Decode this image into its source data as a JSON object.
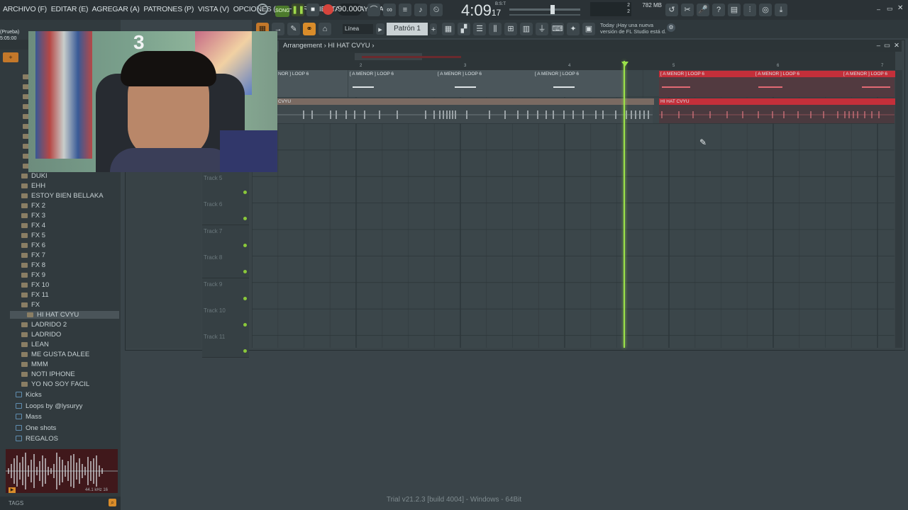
{
  "menu": [
    "ARCHIVO (F)",
    "EDITAR (E)",
    "AGREGAR (A)",
    "PATRONES (P)",
    "VISTA (V)",
    "OPCIONES (O)",
    "HERRAMIENTAS (T)",
    "AYUDA"
  ],
  "transport": {
    "song_label": "SONG",
    "tempo": "90.000",
    "time_main": "4:09",
    "time_sub": "17",
    "bst": "B:S:T",
    "cpu_a": "2",
    "cpu_b": "2",
    "memory": "782 MB"
  },
  "toolbar2": {
    "snap": "Línea",
    "pattern": "Patrón 1"
  },
  "hint": {
    "line1": "Today  ¡Hay una nueva",
    "line2": "versión de FL Studio está d."
  },
  "sidebar_status": {
    "line1": "(Prueba)",
    "line2": "5:05:00"
  },
  "browser": {
    "items": [
      "DUKI",
      "EHH",
      "ESTOY BIEN BELLAKA",
      "FX 2",
      "FX 3",
      "FX 4",
      "FX 5",
      "FX 6",
      "FX 7",
      "FX 8",
      "FX 9",
      "FX 10",
      "FX 11",
      "FX",
      "HI HAT CVYU",
      "LADRIDO 2",
      "LADRIDO",
      "LEAN",
      "ME GUSTA DALEE",
      "MMM",
      "NOTI IPHONE",
      "YO NO SOY FACIL"
    ],
    "folders": [
      "Kicks",
      "Loops by @lysuryy",
      "Mass",
      "One shots",
      "REGALOS"
    ],
    "preview_info": "44.1 kHz 16",
    "tags_label": "TAGS"
  },
  "playlist": {
    "breadcrumb": "Arrangement",
    "pattern_name": "HI HAT CVYU",
    "bar_numbers": [
      "2",
      "3",
      "4",
      "5",
      "6",
      "7"
    ],
    "loop_clip_label": "[ A MENOR ] LOOP 6",
    "loop_clip_label_cut": "NOR ] LOOP 6",
    "hihat_clip_label": "HI HAT CVYU",
    "hihat_clip_label_cut": "CVYU",
    "tracks": [
      "Track 5",
      "Track 6",
      "Track 7",
      "Track 8",
      "Track 9",
      "Track 10",
      "Track 11"
    ]
  },
  "webcam_overlay": "3",
  "footer": "Trial v21.2.3 [build 4004] - Windows - 64Bit",
  "colors": {
    "accent_green": "#9be14a",
    "clip_red": "#c42f3a",
    "clip_grey": "#59646a"
  }
}
